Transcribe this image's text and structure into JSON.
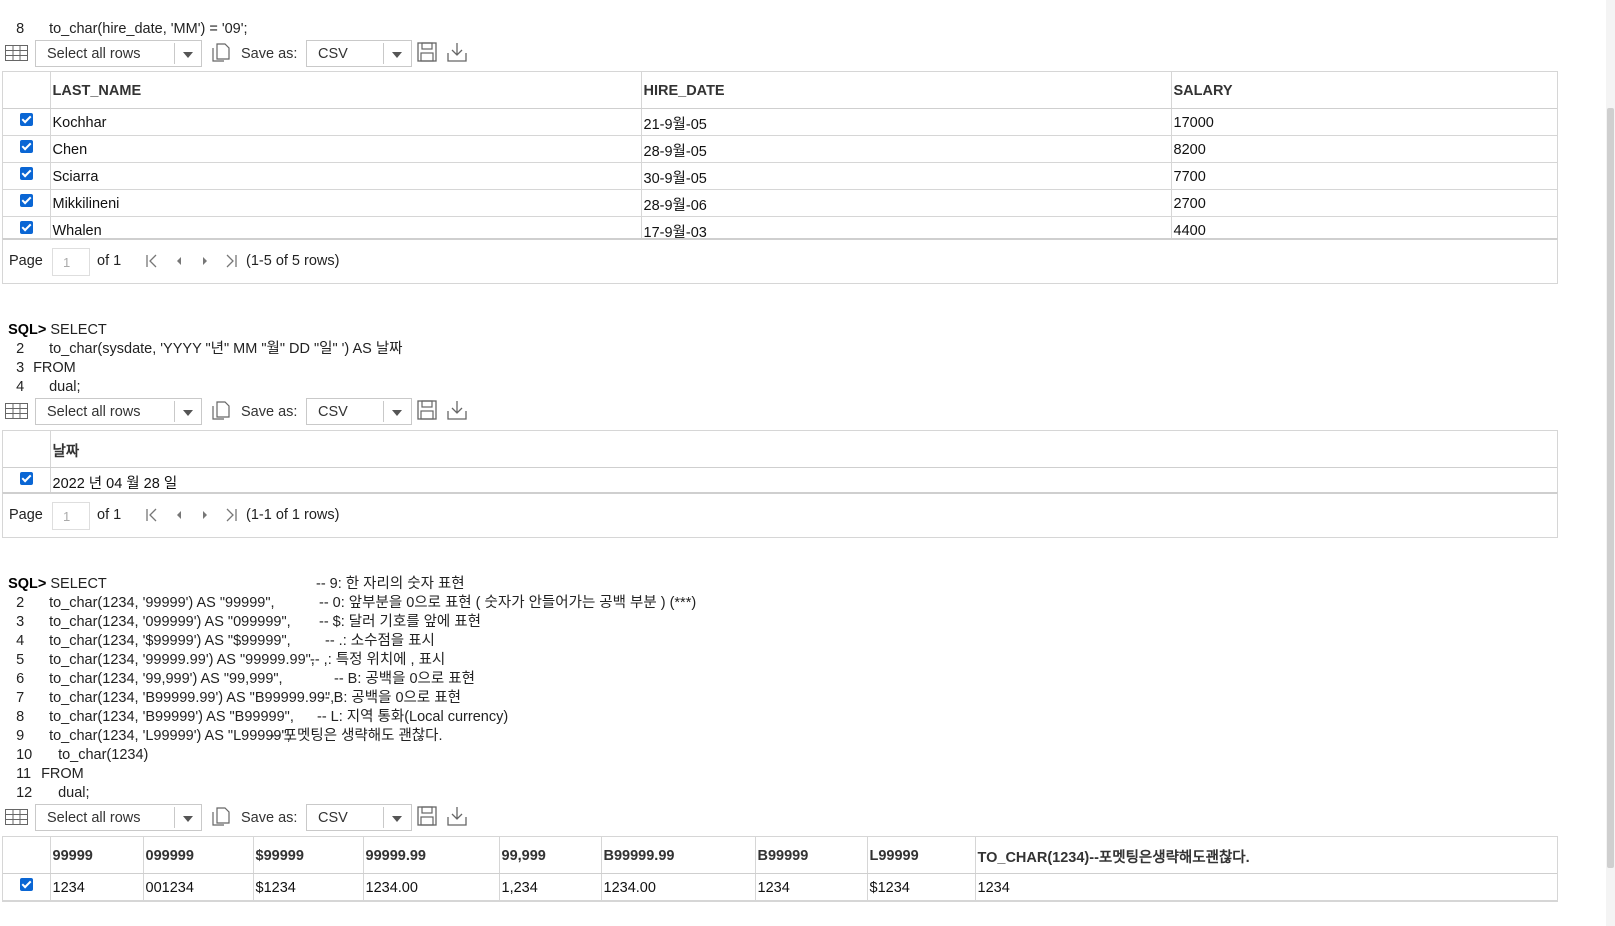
{
  "script_top": {
    "line_number": "8",
    "code": "to_char(hire_date, 'MM') = '09';"
  },
  "toolbar": {
    "select_value": "Select all rows",
    "save_as_label": "Save as:",
    "format_value": "CSV"
  },
  "query1": {
    "headers": [
      "LAST_NAME",
      "HIRE_DATE",
      "SALARY"
    ],
    "rows": [
      [
        "Kochhar",
        "21-9월-05",
        "17000"
      ],
      [
        "Chen",
        "28-9월-05",
        "8200"
      ],
      [
        "Sciarra",
        "30-9월-05",
        "7700"
      ],
      [
        "Mikkilineni",
        "28-9월-06",
        "2700"
      ],
      [
        "Whalen",
        "17-9월-03",
        "4400"
      ]
    ],
    "pager": {
      "page_label": "Page",
      "page_value": "1",
      "of_label": "of 1",
      "rows_label": "(1-5 of 5 rows)"
    }
  },
  "query2": {
    "prompt": "SQL>",
    "lines": [
      {
        "num": "",
        "code": "SELECT"
      },
      {
        "num": "2",
        "code": "to_char(sysdate, 'YYYY \"년\" MM \"월\" DD \"일\" ') AS 날짜"
      },
      {
        "num": "3",
        "code": "FROM"
      },
      {
        "num": "4",
        "code": "dual;"
      }
    ],
    "headers": [
      "날짜"
    ],
    "rows": [
      [
        "2022 년 04 월 28 일"
      ]
    ],
    "pager": {
      "page_label": "Page",
      "page_value": "1",
      "of_label": "of 1",
      "rows_label": "(1-1 of 1 rows)"
    }
  },
  "query3": {
    "prompt": "SQL>",
    "lines": [
      {
        "num": "",
        "code": "SELECT",
        "comment": ""
      },
      {
        "num": "2",
        "code": "to_char(1234, '99999') AS \"99999\",",
        "comment": "-- 9: 한 자리의 숫자 표현"
      },
      {
        "num": "3",
        "code": "to_char(1234, '099999') AS \"099999\",",
        "comment": "-- 0: 앞부분을 0으로 표현 ( 숫자가 안들어가는 공백 부분 ) (***)"
      },
      {
        "num": "4",
        "code": "to_char(1234, '$99999') AS \"$99999\",",
        "comment": "-- $: 달러 기호를 앞에 표현"
      },
      {
        "num": "5",
        "code": "to_char(1234, '99999.99') AS \"99999.99\",",
        "comment": "-- .: 소수점을 표시"
      },
      {
        "num": "6",
        "code": "to_char(1234, '99,999') AS \"99,999\",",
        "comment": "-- ,: 특정 위치에 , 표시"
      },
      {
        "num": "7",
        "code": "to_char(1234, 'B99999.99') AS \"B99999.99\",",
        "comment": "-- B: 공백을 0으로 표현"
      },
      {
        "num": "8",
        "code": "to_char(1234, 'B99999') AS \"B99999\",",
        "comment": "-- B: 공백을 0으로 표현"
      },
      {
        "num": "9",
        "code": "to_char(1234, 'L99999') AS \"L99999\",",
        "comment": "-- L: 지역 통화(Local currency)"
      },
      {
        "num": "10",
        "code": "to_char(1234)",
        "comment": "-- 포멧팅은 생략해도 괜찮다."
      },
      {
        "num": "11",
        "code": "FROM",
        "comment": ""
      },
      {
        "num": "12",
        "code": "dual;",
        "comment": ""
      }
    ],
    "headers": [
      "99999",
      "099999",
      "$99999",
      "99999.99",
      "99,999",
      "B99999.99",
      "B99999",
      "L99999",
      "TO_CHAR(1234)--포멧팅은생략해도괜찮다."
    ],
    "rows": [
      [
        "1234",
        "001234",
        "$1234",
        "1234.00",
        "1,234",
        "1234.00",
        "1234",
        "$1234",
        "1234"
      ]
    ]
  },
  "colors": {
    "checkbox": "#0a66d4",
    "border": "#d6d6d6"
  }
}
